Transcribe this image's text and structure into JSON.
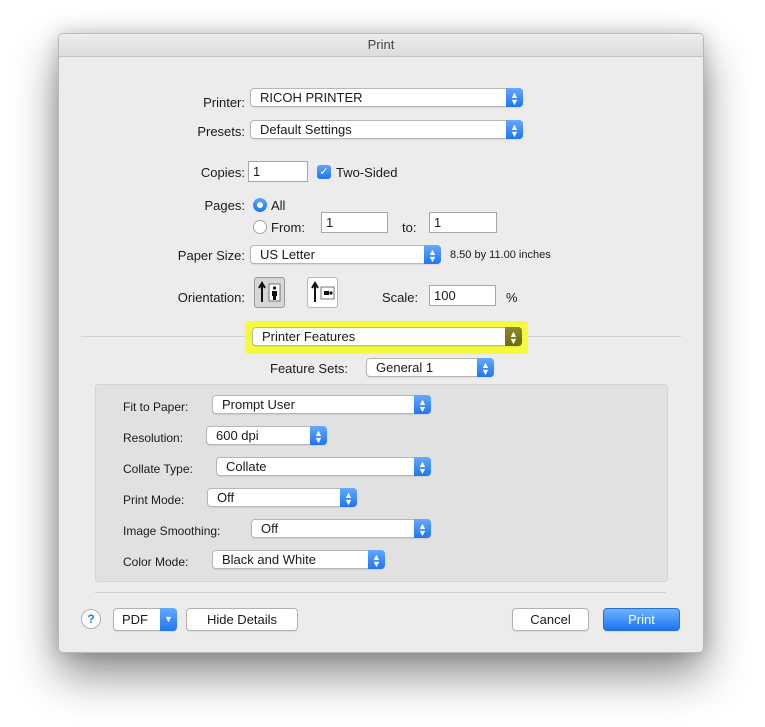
{
  "window": {
    "title": "Print"
  },
  "printer": {
    "label": "Printer:",
    "value": "RICOH PRINTER"
  },
  "presets": {
    "label": "Presets:",
    "value": "Default Settings"
  },
  "copies": {
    "label": "Copies:",
    "value": "1",
    "two_sided_label": "Two-Sided",
    "two_sided_checked": true
  },
  "pages": {
    "label": "Pages:",
    "all_label": "All",
    "from_label": "From:",
    "from_value": "1",
    "to_label": "to:",
    "to_value": "1",
    "selected": "All"
  },
  "paper_size": {
    "label": "Paper Size:",
    "value": "US Letter",
    "dimensions": "8.50 by 11.00 inches"
  },
  "orientation": {
    "label": "Orientation:",
    "options": [
      "portrait-icon",
      "landscape-icon"
    ],
    "selected": "portrait"
  },
  "scale": {
    "label": "Scale:",
    "value": "100",
    "unit": "%"
  },
  "section_popup": {
    "value": "Printer Features",
    "highlight_color": "#f4fb3b"
  },
  "feature_sets": {
    "label": "Feature Sets:",
    "value": "General 1"
  },
  "features": [
    {
      "label": "Fit to Paper:",
      "value": "Prompt User"
    },
    {
      "label": "Resolution:",
      "value": "600 dpi"
    },
    {
      "label": "Collate Type:",
      "value": "Collate"
    },
    {
      "label": "Print Mode:",
      "value": "Off"
    },
    {
      "label": "Image Smoothing:",
      "value": "Off"
    },
    {
      "label": "Color Mode:",
      "value": "Black and White"
    }
  ],
  "footer": {
    "help": "?",
    "pdf": "PDF",
    "hide_details": "Hide Details",
    "cancel": "Cancel",
    "print": "Print"
  },
  "colors": {
    "accent": "#1f76f0",
    "highlight": "#f4fb3b"
  }
}
